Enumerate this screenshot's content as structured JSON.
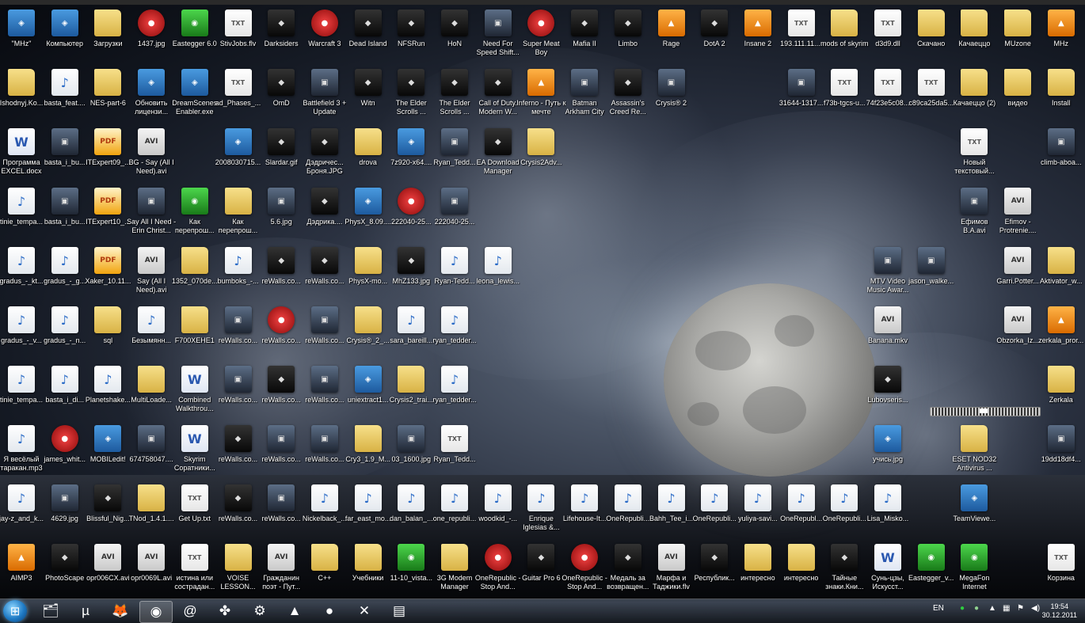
{
  "colors": {
    "taskbar": "#1b2029",
    "label": "#ffffff",
    "folder": "#e8c560",
    "accent": "#1f7ac4"
  },
  "desktop_icons": [
    {
      "label": "\"MHz\"",
      "kind": "app",
      "icon": "joystick-icon"
    },
    {
      "label": "Компьютер",
      "kind": "app",
      "icon": "computer-icon"
    },
    {
      "label": "Загрузки",
      "kind": "folder",
      "icon": "folder-icon"
    },
    {
      "label": "1437.jpg",
      "kind": "red",
      "icon": "image-icon"
    },
    {
      "label": "Eastegger 6.0",
      "kind": "green",
      "icon": "app-icon"
    },
    {
      "label": "StivJobs.flv",
      "kind": "txt",
      "icon": "video-icon"
    },
    {
      "label": "Darksiders",
      "kind": "dark",
      "icon": "game-icon"
    },
    {
      "label": "Warcraft 3",
      "kind": "red",
      "icon": "game-icon"
    },
    {
      "label": "Dead Island",
      "kind": "dark",
      "icon": "game-icon"
    },
    {
      "label": "NFSRun",
      "kind": "dark",
      "icon": "game-icon"
    },
    {
      "label": "HoN",
      "kind": "dark",
      "icon": "game-icon"
    },
    {
      "label": "Need For Speed Shift...",
      "kind": "img",
      "icon": "game-icon"
    },
    {
      "label": "Super Meat Boy",
      "kind": "red",
      "icon": "game-icon"
    },
    {
      "label": "Mafia II",
      "kind": "dark",
      "icon": "game-icon"
    },
    {
      "label": "Limbo",
      "kind": "dark",
      "icon": "game-icon"
    },
    {
      "label": "Rage",
      "kind": "orange",
      "icon": "game-icon"
    },
    {
      "label": "DotA 2",
      "kind": "dark",
      "icon": "game-icon"
    },
    {
      "label": "Insane 2",
      "kind": "orange",
      "icon": "game-icon"
    },
    {
      "label": "193.111.11....",
      "kind": "txt",
      "icon": "text-file-icon"
    },
    {
      "label": "mods of skyrim",
      "kind": "folder",
      "icon": "folder-icon"
    },
    {
      "label": "d3d9.dll",
      "kind": "txt",
      "icon": "dll-icon"
    },
    {
      "label": "Скачано",
      "kind": "folder",
      "icon": "folder-icon"
    },
    {
      "label": "Качаеццо",
      "kind": "folder",
      "icon": "folder-icon"
    },
    {
      "label": "MUzone",
      "kind": "folder",
      "icon": "folder-icon"
    },
    {
      "label": "MHz",
      "kind": "orange",
      "icon": "warning-icon"
    },
    {
      "label": "Ishodnyj.Ko...",
      "kind": "folder",
      "icon": "folder-icon"
    },
    {
      "label": "basta_feat....",
      "kind": "mp3",
      "icon": "music-file-icon"
    },
    {
      "label": "NES-part-6",
      "kind": "folder",
      "icon": "folder-icon"
    },
    {
      "label": "Обновить лицензи...",
      "kind": "app",
      "icon": "app-icon"
    },
    {
      "label": "DreamScenes Enabler.exe",
      "kind": "app",
      "icon": "laptop-icon"
    },
    {
      "label": "ad_Phases_...",
      "kind": "txt",
      "icon": "file-icon"
    },
    {
      "label": "OmD",
      "kind": "dark",
      "icon": "game-icon"
    },
    {
      "label": "Battlefield 3 + Update",
      "kind": "img",
      "icon": "game-icon"
    },
    {
      "label": "Witn",
      "kind": "dark",
      "icon": "game-icon"
    },
    {
      "label": "The Elder Scrolls ...",
      "kind": "dark",
      "icon": "game-icon"
    },
    {
      "label": "The Elder Scrolls ...",
      "kind": "dark",
      "icon": "game-icon"
    },
    {
      "label": "Call of Duty. Modern W...",
      "kind": "dark",
      "icon": "game-icon"
    },
    {
      "label": "Inferno - Путь к мечте",
      "kind": "orange",
      "icon": "radiation-icon"
    },
    {
      "label": "Batman Arkham City",
      "kind": "img",
      "icon": "game-icon"
    },
    {
      "label": "Assassin's Creed Re...",
      "kind": "dark",
      "icon": "game-icon"
    },
    {
      "label": "Crysis® 2",
      "kind": "img",
      "icon": "game-icon"
    },
    {
      "label": "31644-1317...",
      "kind": "img",
      "icon": "image-icon"
    },
    {
      "label": "f73b-tgcs-u...",
      "kind": "txt",
      "icon": "text-file-icon"
    },
    {
      "label": "74f23e5c08...",
      "kind": "txt",
      "icon": "file-icon"
    },
    {
      "label": "c89ca25da5...",
      "kind": "txt",
      "icon": "file-icon"
    },
    {
      "label": "Качаеццо (2)",
      "kind": "folder",
      "icon": "folder-icon"
    },
    {
      "label": "видео",
      "kind": "folder",
      "icon": "folder-icon"
    },
    {
      "label": "Install",
      "kind": "folder",
      "icon": "folder-icon"
    },
    {
      "label": "Программа EXCEL.docx",
      "kind": "doc",
      "icon": "word-doc-icon"
    },
    {
      "label": "basta_i_bu...",
      "kind": "img",
      "icon": "image-icon"
    },
    {
      "label": "ITExpert09_...",
      "kind": "pdf",
      "icon": "pdf-icon"
    },
    {
      "label": "BG - Say (All I Need).avi",
      "kind": "avi",
      "icon": "video-icon"
    },
    {
      "label": "2008030715...",
      "kind": "app",
      "icon": "app-icon"
    },
    {
      "label": "Slardar.gif",
      "kind": "dark",
      "icon": "image-icon"
    },
    {
      "label": "Дэдричес... Броня.JPG",
      "kind": "dark",
      "icon": "image-icon"
    },
    {
      "label": "drova",
      "kind": "folder",
      "icon": "folder-icon"
    },
    {
      "label": "7z920-x64....",
      "kind": "app",
      "icon": "installer-icon"
    },
    {
      "label": "Ryan_Tedd...",
      "kind": "img",
      "icon": "image-icon"
    },
    {
      "label": "EA Download Manager",
      "kind": "dark",
      "icon": "app-icon"
    },
    {
      "label": "Crysis2Adv...",
      "kind": "folder",
      "icon": "folder-icon"
    },
    {
      "label": "Новый текстовый...",
      "kind": "txt",
      "icon": "text-file-icon"
    },
    {
      "label": "climb-aboa...",
      "kind": "img",
      "icon": "image-icon"
    },
    {
      "label": "tinie_tempa...",
      "kind": "mp3",
      "icon": "music-file-icon"
    },
    {
      "label": "basta_i_bu...",
      "kind": "img",
      "icon": "image-icon"
    },
    {
      "label": "ITExpert10_...",
      "kind": "pdf",
      "icon": "pdf-icon"
    },
    {
      "label": "Say All I Need - Erin Christ...",
      "kind": "img",
      "icon": "image-icon"
    },
    {
      "label": "Как перепрош...",
      "kind": "green",
      "icon": "chrome-icon"
    },
    {
      "label": "Как перепрош...",
      "kind": "folder",
      "icon": "folder-icon"
    },
    {
      "label": "5.6.jpg",
      "kind": "img",
      "icon": "image-icon"
    },
    {
      "label": "Дэдрика....",
      "kind": "dark",
      "icon": "image-icon"
    },
    {
      "label": "PhysX_8.09....",
      "kind": "app",
      "icon": "installer-icon"
    },
    {
      "label": "222040-25...",
      "kind": "red",
      "icon": "image-icon"
    },
    {
      "label": "222040-25...",
      "kind": "img",
      "icon": "image-icon"
    },
    {
      "label": "Ефимов В.А.avi",
      "kind": "img",
      "icon": "video-icon"
    },
    {
      "label": "Efimov - Protrenie....",
      "kind": "avi",
      "icon": "video-icon"
    },
    {
      "label": "gradus_-_kt...",
      "kind": "mp3",
      "icon": "music-file-icon"
    },
    {
      "label": "gradus_-_g...",
      "kind": "mp3",
      "icon": "music-file-icon"
    },
    {
      "label": "Xaker_10.11...",
      "kind": "pdf",
      "icon": "pdf-icon"
    },
    {
      "label": "Say (All I Need).avi",
      "kind": "avi",
      "icon": "video-icon"
    },
    {
      "label": "1352_070de...",
      "kind": "folder",
      "icon": "folder-icon"
    },
    {
      "label": "bumboks_-...",
      "kind": "mp3",
      "icon": "music-file-icon"
    },
    {
      "label": "reWalls.co...",
      "kind": "dark",
      "icon": "image-icon"
    },
    {
      "label": "reWalls.co...",
      "kind": "dark",
      "icon": "image-icon"
    },
    {
      "label": "PhysX-mo...",
      "kind": "folder",
      "icon": "folder-icon"
    },
    {
      "label": "MhZ133.jpg",
      "kind": "dark",
      "icon": "image-icon"
    },
    {
      "label": "Ryan-Tedd...",
      "kind": "mp3",
      "icon": "music-file-icon"
    },
    {
      "label": "leona_lewis...",
      "kind": "mp3",
      "icon": "music-file-icon"
    },
    {
      "label": "MTV Video Music Awar...",
      "kind": "img",
      "icon": "video-icon"
    },
    {
      "label": "jason_walke...",
      "kind": "img",
      "icon": "image-icon"
    },
    {
      "label": "Garri.Potter...",
      "kind": "avi",
      "icon": "video-icon"
    },
    {
      "label": "Aktivator_w...",
      "kind": "folder",
      "icon": "folder-icon"
    },
    {
      "label": "gradus_-_v...",
      "kind": "mp3",
      "icon": "music-file-icon"
    },
    {
      "label": "gradus_-_n...",
      "kind": "mp3",
      "icon": "music-file-icon"
    },
    {
      "label": "sql",
      "kind": "folder",
      "icon": "folder-icon"
    },
    {
      "label": "Безымянн...",
      "kind": "mp3",
      "icon": "music-file-icon"
    },
    {
      "label": "F700XEHE1",
      "kind": "folder",
      "icon": "folder-icon"
    },
    {
      "label": "reWalls.co...",
      "kind": "img",
      "icon": "image-icon"
    },
    {
      "label": "reWalls.co...",
      "kind": "red",
      "icon": "image-icon"
    },
    {
      "label": "reWalls.co...",
      "kind": "img",
      "icon": "image-icon"
    },
    {
      "label": "Crysis®_2_...",
      "kind": "folder",
      "icon": "folder-icon"
    },
    {
      "label": "sara_bareill...",
      "kind": "mp3",
      "icon": "music-file-icon"
    },
    {
      "label": "ryan_tedder...",
      "kind": "mp3",
      "icon": "music-file-icon"
    },
    {
      "label": "Banana.mkv",
      "kind": "avi",
      "icon": "video-icon"
    },
    {
      "label": "Obzorka_Iz...",
      "kind": "avi",
      "icon": "video-icon"
    },
    {
      "label": "zerkala_pror...",
      "kind": "orange",
      "icon": "video-icon"
    },
    {
      "label": "tinie_tempa...",
      "kind": "mp3",
      "icon": "music-file-icon"
    },
    {
      "label": "basta_i_di...",
      "kind": "mp3",
      "icon": "music-file-icon"
    },
    {
      "label": "Planetshake...",
      "kind": "mp3",
      "icon": "music-file-icon"
    },
    {
      "label": "MultiLoade...",
      "kind": "folder",
      "icon": "folder-icon"
    },
    {
      "label": "Combined Walkthrou...",
      "kind": "doc",
      "icon": "word-doc-icon"
    },
    {
      "label": "reWalls.co...",
      "kind": "img",
      "icon": "image-icon"
    },
    {
      "label": "reWalls.co...",
      "kind": "dark",
      "icon": "image-icon"
    },
    {
      "label": "reWalls.co...",
      "kind": "img",
      "icon": "image-icon"
    },
    {
      "label": "uniextract1...",
      "kind": "app",
      "icon": "installer-icon"
    },
    {
      "label": "Crysis2_trai...",
      "kind": "folder",
      "icon": "folder-icon"
    },
    {
      "label": "ryan_tedder...",
      "kind": "mp3",
      "icon": "music-file-icon"
    },
    {
      "label": "Lubovseris...",
      "kind": "dark",
      "icon": "video-icon"
    },
    {
      "label": "Zerkala",
      "kind": "folder",
      "icon": "folder-icon"
    },
    {
      "label": "Я весёлый таракан.mp3",
      "kind": "mp3",
      "icon": "music-file-icon"
    },
    {
      "label": "james_whit...",
      "kind": "red",
      "icon": "image-icon"
    },
    {
      "label": "MOBILedit!",
      "kind": "app",
      "icon": "phone-icon"
    },
    {
      "label": "674758047....",
      "kind": "img",
      "icon": "image-icon"
    },
    {
      "label": "Skyrim Соратники...",
      "kind": "doc",
      "icon": "word-doc-icon"
    },
    {
      "label": "reWalls.co...",
      "kind": "dark",
      "icon": "image-icon"
    },
    {
      "label": "reWalls.co...",
      "kind": "img",
      "icon": "image-icon"
    },
    {
      "label": "reWalls.co...",
      "kind": "img",
      "icon": "image-icon"
    },
    {
      "label": "Cry3_1.9_M...",
      "kind": "folder",
      "icon": "folder-icon"
    },
    {
      "label": "03_1600.jpg",
      "kind": "img",
      "icon": "image-icon"
    },
    {
      "label": "Ryan_Tedd...",
      "kind": "txt",
      "icon": "playlist-icon"
    },
    {
      "label": "учись.jpg",
      "kind": "app",
      "icon": "image-icon"
    },
    {
      "label": "ESET NOD32 Antivirus ...",
      "kind": "folder",
      "icon": "folder-icon"
    },
    {
      "label": "19dd18df4...",
      "kind": "img",
      "icon": "image-icon"
    },
    {
      "label": "jay-z_and_k...",
      "kind": "mp3",
      "icon": "music-file-icon"
    },
    {
      "label": "4629.jpg",
      "kind": "img",
      "icon": "image-icon"
    },
    {
      "label": "Blissful_Nig...",
      "kind": "dark",
      "icon": "video-icon"
    },
    {
      "label": "TNod_1.4.1....",
      "kind": "folder",
      "icon": "folder-icon"
    },
    {
      "label": "Get Up.txt",
      "kind": "txt",
      "icon": "text-file-icon"
    },
    {
      "label": "reWalls.co...",
      "kind": "dark",
      "icon": "image-icon"
    },
    {
      "label": "reWalls.co...",
      "kind": "img",
      "icon": "image-icon"
    },
    {
      "label": "Nickelback_...",
      "kind": "mp3",
      "icon": "music-file-icon"
    },
    {
      "label": "far_east_mo...",
      "kind": "mp3",
      "icon": "music-file-icon"
    },
    {
      "label": "dan_balan_...",
      "kind": "mp3",
      "icon": "music-file-icon"
    },
    {
      "label": "one_republi...",
      "kind": "mp3",
      "icon": "music-file-icon"
    },
    {
      "label": "woodkid_-...",
      "kind": "mp3",
      "icon": "music-file-icon"
    },
    {
      "label": "Enrique Iglesias &...",
      "kind": "mp3",
      "icon": "music-file-icon"
    },
    {
      "label": "Lifehouse-It...",
      "kind": "mp3",
      "icon": "music-file-icon"
    },
    {
      "label": "OneRepubli...",
      "kind": "mp3",
      "icon": "music-file-icon"
    },
    {
      "label": "Bahh_Tee_i...",
      "kind": "mp3",
      "icon": "music-file-icon"
    },
    {
      "label": "OneRepubli...",
      "kind": "mp3",
      "icon": "music-file-icon"
    },
    {
      "label": "yuliya-savi...",
      "kind": "mp3",
      "icon": "music-file-icon"
    },
    {
      "label": "OneRepubl...",
      "kind": "mp3",
      "icon": "music-file-icon"
    },
    {
      "label": "OneRepubli...",
      "kind": "mp3",
      "icon": "music-file-icon"
    },
    {
      "label": "Lisa_Misko...",
      "kind": "mp3",
      "icon": "music-file-icon"
    },
    {
      "label": "TeamViewe...",
      "kind": "app",
      "icon": "teamviewer-icon"
    },
    {
      "label": "AIMP3",
      "kind": "orange",
      "icon": "aimp-icon"
    },
    {
      "label": "PhotoScape",
      "kind": "dark",
      "icon": "photoscape-icon"
    },
    {
      "label": "opr006CX.avi",
      "kind": "avi",
      "icon": "video-icon"
    },
    {
      "label": "opr0069L.avi",
      "kind": "avi",
      "icon": "video-icon"
    },
    {
      "label": "истина или сострадан...",
      "kind": "txt",
      "icon": "text-file-icon"
    },
    {
      "label": "VOISE LESSON...",
      "kind": "folder",
      "icon": "folder-icon"
    },
    {
      "label": "Гражданин поэт - Пут...",
      "kind": "avi",
      "icon": "video-icon"
    },
    {
      "label": "C++",
      "kind": "folder",
      "icon": "folder-icon"
    },
    {
      "label": "Учебники",
      "kind": "folder",
      "icon": "folder-icon"
    },
    {
      "label": "11-10_vista...",
      "kind": "green",
      "icon": "amd-icon"
    },
    {
      "label": "3G Modem Manager",
      "kind": "folder",
      "icon": "folder-icon"
    },
    {
      "label": "OneRepublic - Stop And...",
      "kind": "red",
      "icon": "video-icon"
    },
    {
      "label": "Guitar Pro 6",
      "kind": "dark",
      "icon": "guitar-icon"
    },
    {
      "label": "OneRepublic - Stop And...",
      "kind": "red",
      "icon": "video-icon"
    },
    {
      "label": "Медаль за возвращен...",
      "kind": "dark",
      "icon": "video-icon"
    },
    {
      "label": "Марфа и Таджики.flv",
      "kind": "avi",
      "icon": "video-icon"
    },
    {
      "label": "Республик...",
      "kind": "dark",
      "icon": "video-icon"
    },
    {
      "label": "интересно",
      "kind": "folder",
      "icon": "folder-icon"
    },
    {
      "label": "интересно",
      "kind": "folder",
      "icon": "folder-icon"
    },
    {
      "label": "Тайные знаки.Кни...",
      "kind": "dark",
      "icon": "video-icon"
    },
    {
      "label": "Сунь-цзы, Искусст...",
      "kind": "doc",
      "icon": "word-doc-icon"
    },
    {
      "label": "Eastegger_v...",
      "kind": "green",
      "icon": "app-icon"
    },
    {
      "label": "MegaFon Internet",
      "kind": "green",
      "icon": "megafon-icon"
    },
    {
      "label": "Корзина",
      "kind": "txt",
      "icon": "recycle-bin-icon"
    }
  ],
  "taskbar": {
    "start_label": "Start",
    "pinned": [
      {
        "name": "explorer-icon",
        "glyph": "🗂"
      },
      {
        "name": "utorrent-icon",
        "glyph": "µ"
      },
      {
        "name": "firefox-icon",
        "glyph": "🦊"
      },
      {
        "name": "chrome-icon",
        "glyph": "◉"
      },
      {
        "name": "mail-agent-icon",
        "glyph": "@"
      },
      {
        "name": "puzzle-icon",
        "glyph": "✤"
      },
      {
        "name": "media-icon",
        "glyph": "⚙"
      },
      {
        "name": "aimp-icon",
        "glyph": "▲"
      },
      {
        "name": "opera-icon",
        "glyph": "●"
      },
      {
        "name": "xfire-icon",
        "glyph": "✕"
      },
      {
        "name": "folder-icon",
        "glyph": "▤"
      }
    ],
    "language": "EN",
    "time": "19:54",
    "date": "30.12.2011"
  }
}
